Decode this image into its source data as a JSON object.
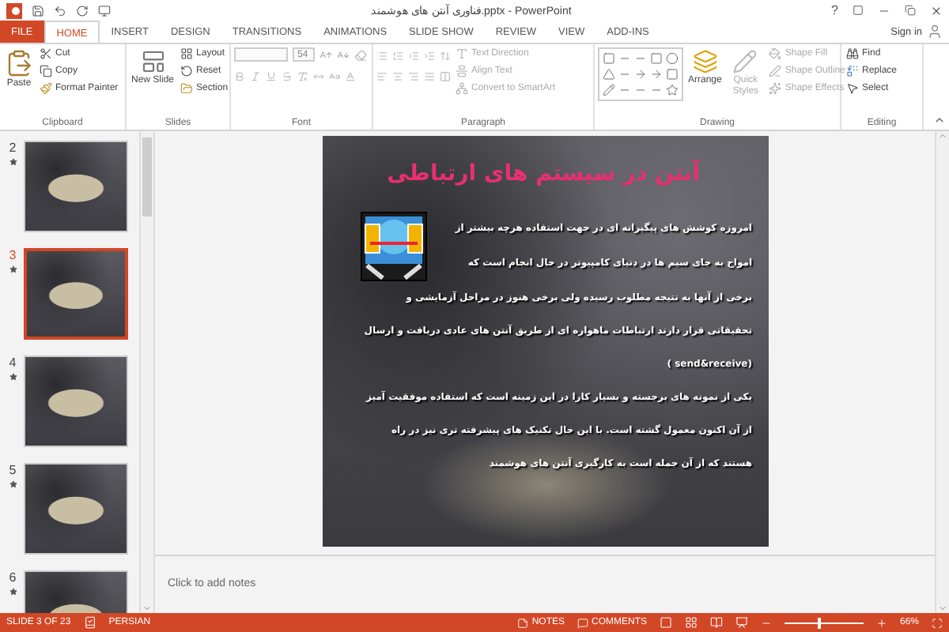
{
  "window": {
    "title": "فناوری آنتن های هوشمند.pptx - PowerPoint",
    "help": "?"
  },
  "tabs": [
    {
      "label": "FILE",
      "kind": "file",
      "selected": false
    },
    {
      "label": "HOME",
      "kind": "tab",
      "selected": true
    },
    {
      "label": "INSERT",
      "kind": "tab",
      "selected": false
    },
    {
      "label": "DESIGN",
      "kind": "tab",
      "selected": false
    },
    {
      "label": "TRANSITIONS",
      "kind": "tab",
      "selected": false
    },
    {
      "label": "ANIMATIONS",
      "kind": "tab",
      "selected": false
    },
    {
      "label": "SLIDE SHOW",
      "kind": "tab",
      "selected": false
    },
    {
      "label": "REVIEW",
      "kind": "tab",
      "selected": false
    },
    {
      "label": "VIEW",
      "kind": "tab",
      "selected": false
    },
    {
      "label": "ADD-INS",
      "kind": "tab",
      "selected": false
    }
  ],
  "sign_in": "Sign in",
  "ribbon": {
    "clipboard": {
      "label": "Clipboard",
      "paste": "Paste",
      "cut": "Cut",
      "copy": "Copy",
      "format_painter": "Format Painter"
    },
    "slides": {
      "label": "Slides",
      "new_slide": "New Slide",
      "layout": "Layout",
      "reset": "Reset",
      "section": "Section"
    },
    "font": {
      "label": "Font",
      "size": "54"
    },
    "paragraph": {
      "label": "Paragraph",
      "commands": [
        {
          "label": "Text Direction",
          "disabled": true
        },
        {
          "label": "Align Text",
          "disabled": true
        },
        {
          "label": "Convert to SmartArt",
          "disabled": true
        }
      ]
    },
    "drawing": {
      "label": "Drawing",
      "arrange": "Arrange",
      "quick_styles": {
        "label": "Quick Styles",
        "disabled": true
      },
      "commands": [
        {
          "label": "Shape Fill",
          "disabled": true
        },
        {
          "label": "Shape Outline",
          "disabled": true
        },
        {
          "label": "Shape Effects",
          "disabled": true
        }
      ]
    },
    "editing": {
      "label": "Editing",
      "find": "Find",
      "replace": "Replace",
      "select": "Select"
    }
  },
  "thumbnails": [
    {
      "number": "2",
      "selected": false
    },
    {
      "number": "3",
      "selected": true
    },
    {
      "number": "4",
      "selected": false
    },
    {
      "number": "5",
      "selected": false
    },
    {
      "number": "6",
      "selected": false
    }
  ],
  "slide": {
    "title": "آنتن در سیستم های ارتباطی",
    "lines": [
      "امروزه کوشش های پیگیرانه ای در جهت استفاده هرچه بیشتر از",
      "امواج به جای سیم ها در دنیای کامپیوتر در حال انجام است که",
      "برخی از آنها به نتیجه مطلوب رسیده ولی برخی هنوز در مراحل آزمایشی و",
      "تحقیقاتی قرار دارند ارتباطات ماهواره ای از طریق آنتن های عادی دریافت و ارسال",
      "(send&receive )",
      "یکی از نمونه های برجسته و بسیار کارا در این زمینه است که استفاده موفقیت آمیز",
      "از آن اکنون معمول گشته است. با این حال تکنیک های پیشرفته تری نیز در راه",
      "هستند که از آن جمله است به کارگیری آنتن های هوشمند"
    ]
  },
  "notes": {
    "placeholder": "Click to add notes"
  },
  "status_bar": {
    "slide_indicator": "SLIDE 3 OF 23",
    "language": "PERSIAN",
    "notes": "NOTES",
    "comments": "COMMENTS",
    "zoom": "66%",
    "zoom_slider": {
      "level": 0.42
    }
  }
}
